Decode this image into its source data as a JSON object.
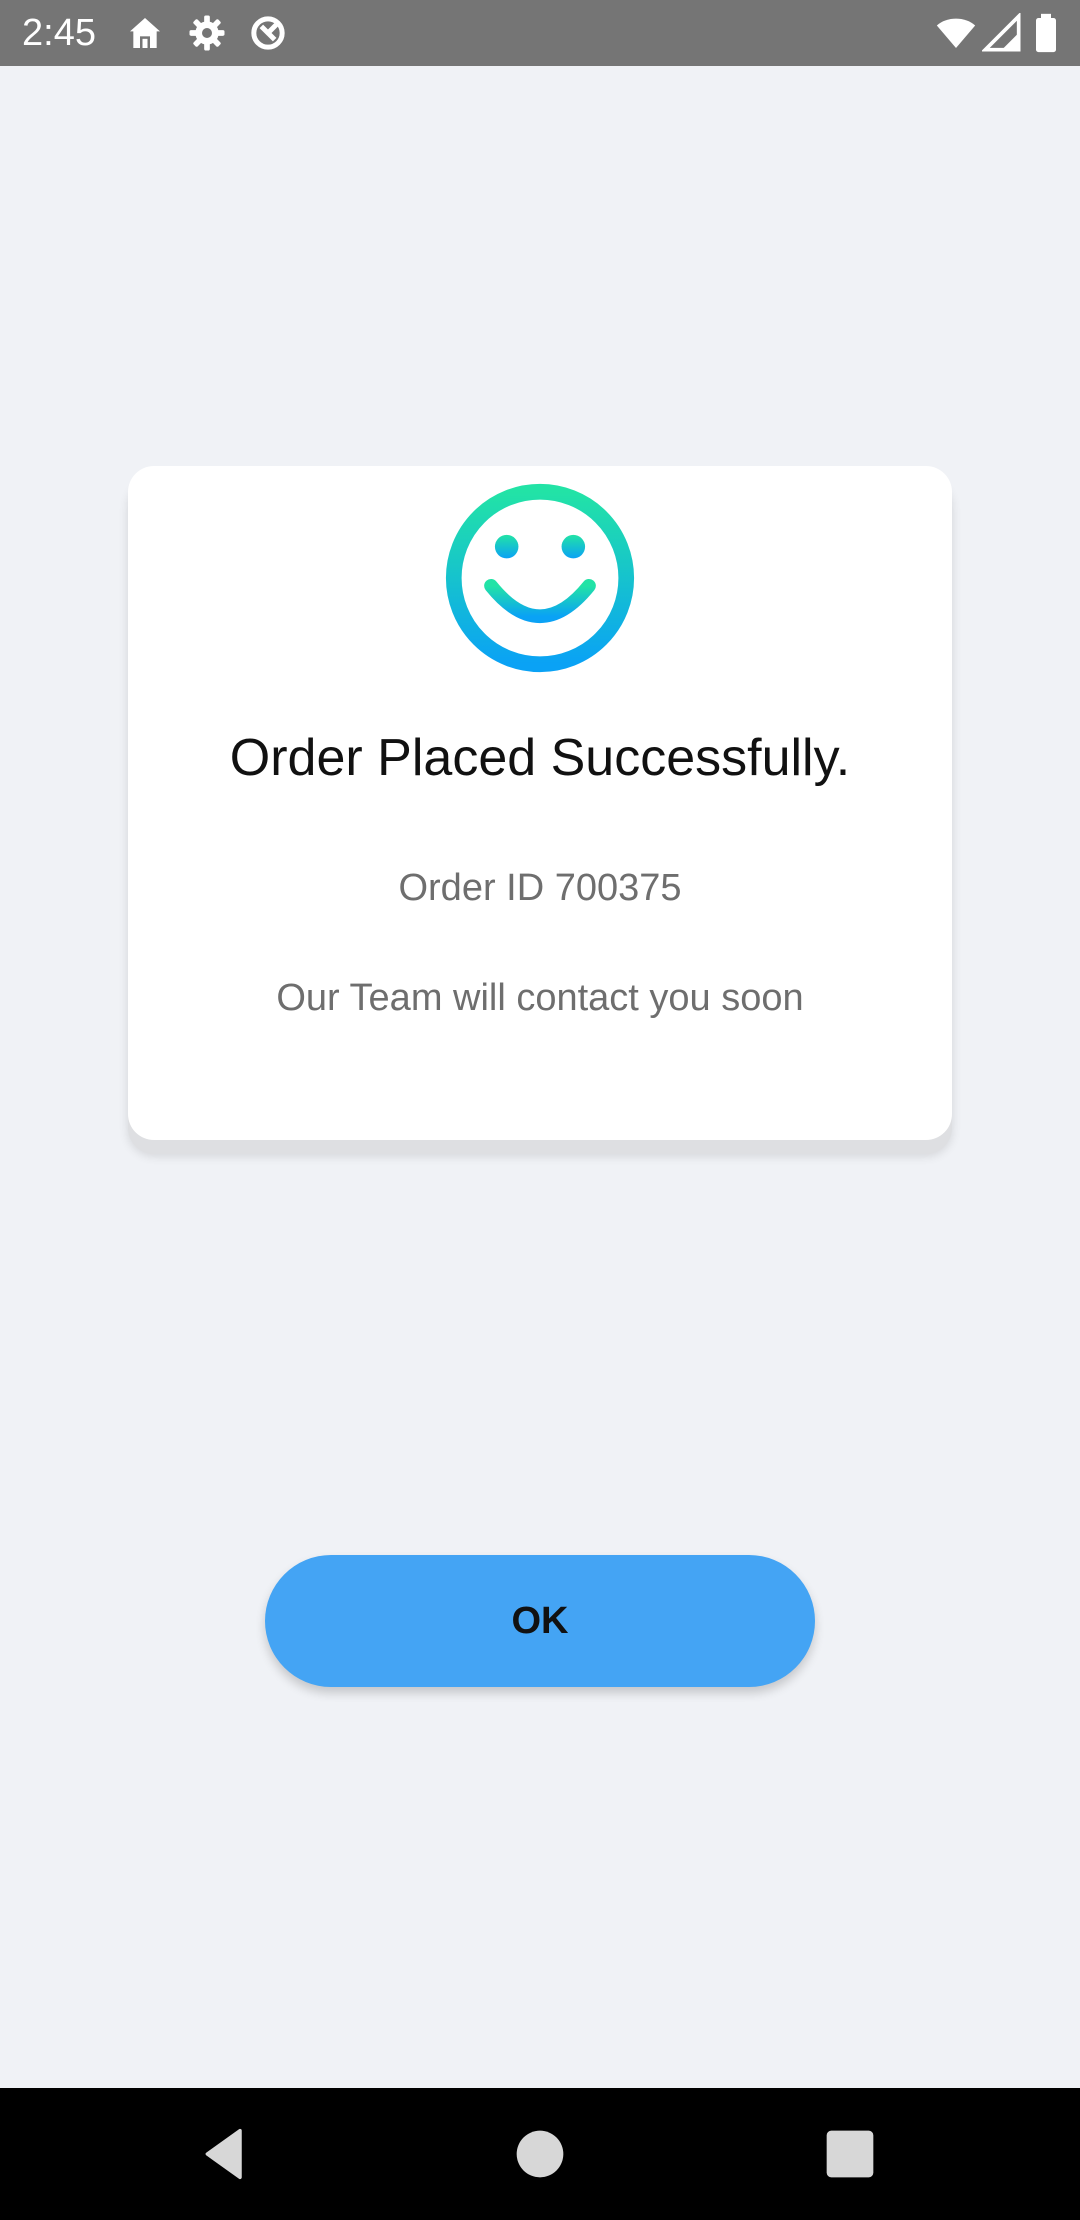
{
  "status_bar": {
    "time": "2:45",
    "icons": [
      "home-icon",
      "settings-gear-icon",
      "data-saver-icon",
      "wifi-icon",
      "cellular-signal-icon",
      "battery-icon"
    ]
  },
  "dialog": {
    "icon": "smiley-face-icon",
    "title": "Order Placed Successfully.",
    "order_id": "Order ID 700375",
    "message": "Our Team will contact you soon"
  },
  "ok_button": {
    "label": "OK"
  },
  "nav_bar": {
    "icons": [
      "back-icon",
      "home-icon",
      "recents-icon"
    ]
  },
  "colors": {
    "status_bar": "#757575",
    "background": "#f0f2f6",
    "card": "#ffffff",
    "button": "#44a4f4",
    "smiley_gradient_top": "#22e3a6",
    "smiley_gradient_bottom": "#0aa2f5",
    "nav_bar": "#000000"
  }
}
